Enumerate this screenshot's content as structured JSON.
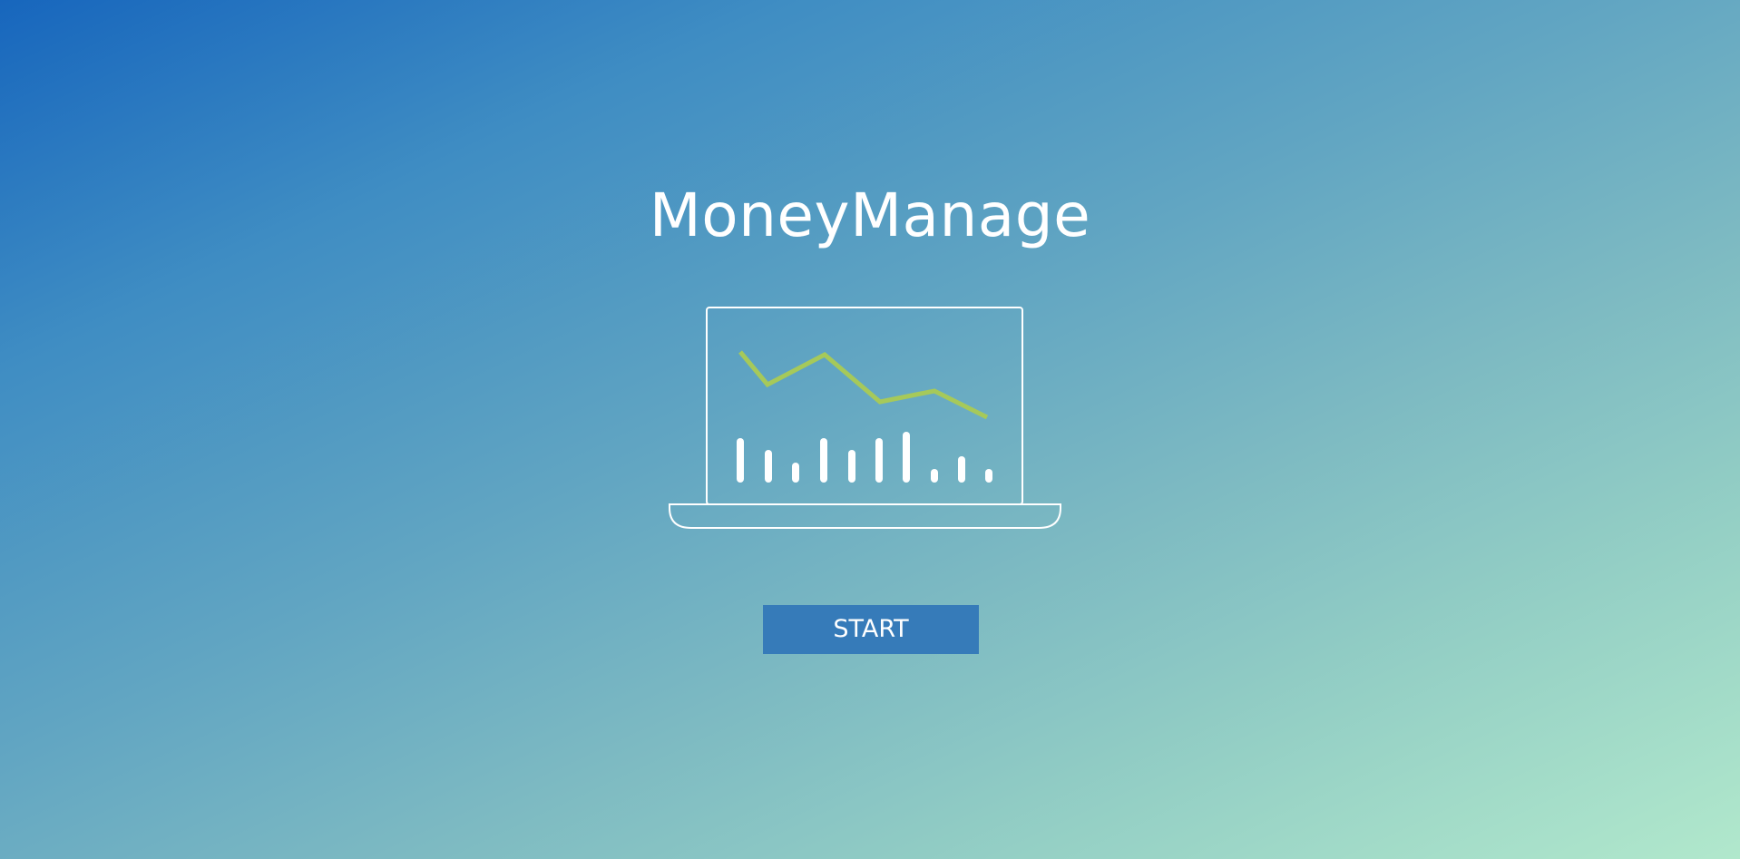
{
  "app": {
    "title": "MoneyManage"
  },
  "illustration": {
    "icon": "laptop-chart-icon",
    "line_color": "#a6c95a",
    "bar_color": "#ffffff",
    "outline_color": "#ffffff"
  },
  "actions": {
    "start_label": "START",
    "start_color": "#367bb9"
  },
  "theme": {
    "gradient_start": "#1766bd",
    "gradient_end": "#b1e8cc",
    "text_color": "#ffffff"
  }
}
